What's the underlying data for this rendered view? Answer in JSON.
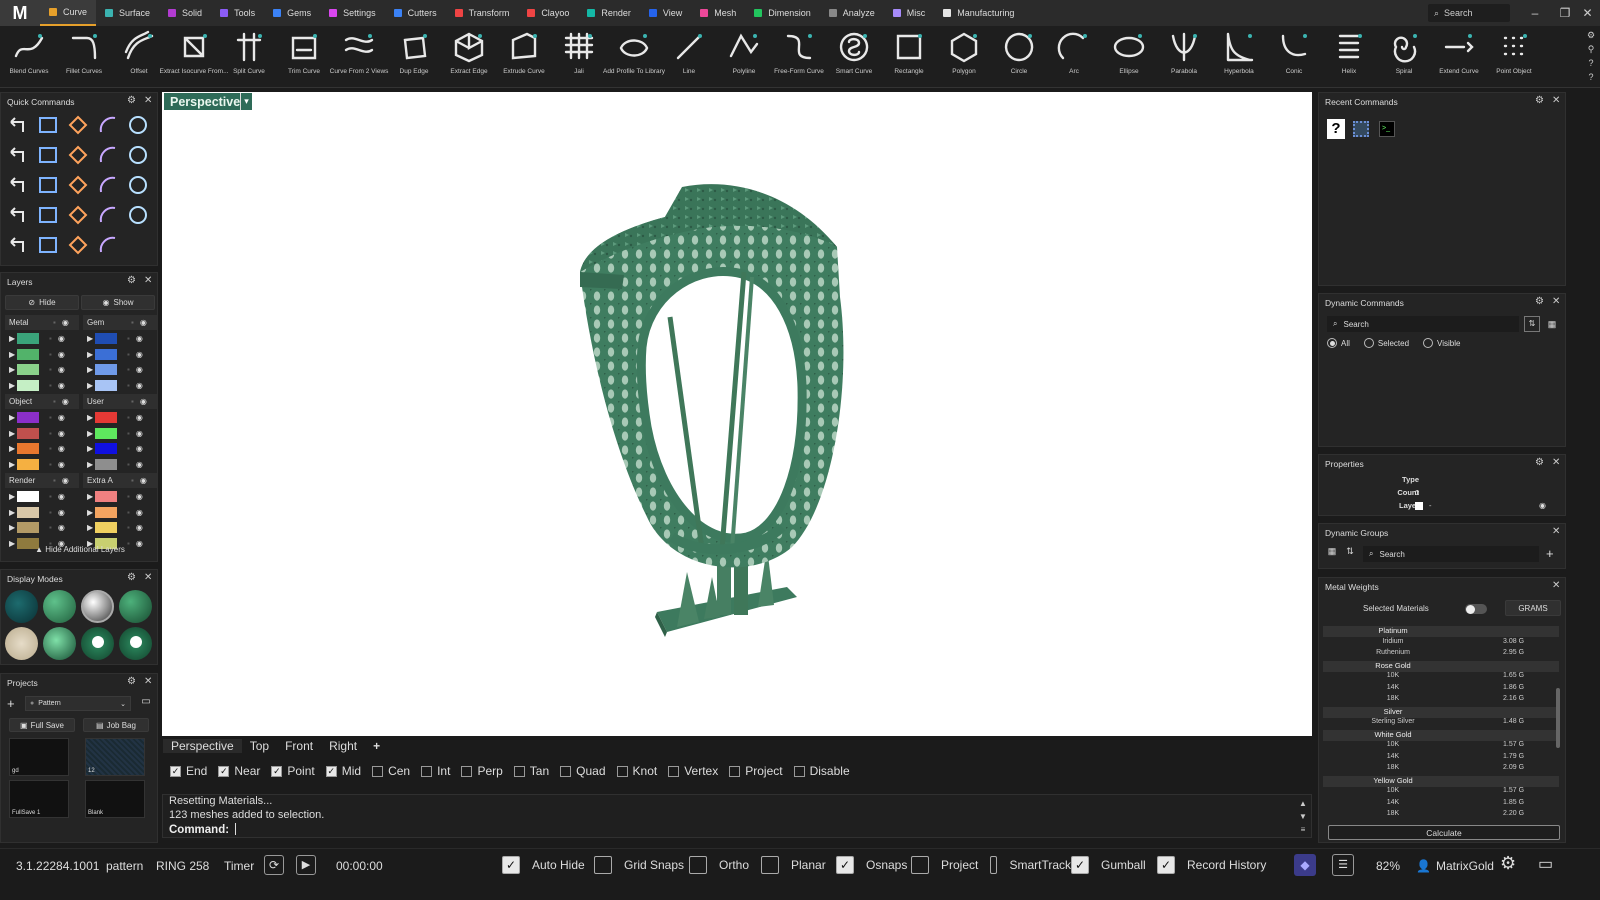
{
  "app": {
    "logo": "M"
  },
  "menu": {
    "tabs": [
      {
        "label": "Curve",
        "color": "#e6a02b"
      },
      {
        "label": "Surface",
        "color": "#3bb3b0"
      },
      {
        "label": "Solid",
        "color": "#b23bd1"
      },
      {
        "label": "Tools",
        "color": "#8b5cf6"
      },
      {
        "label": "Gems",
        "color": "#3b82f6"
      },
      {
        "label": "Settings",
        "color": "#d946ef"
      },
      {
        "label": "Cutters",
        "color": "#3b82f6"
      },
      {
        "label": "Transform",
        "color": "#ef4444"
      },
      {
        "label": "Clayoo",
        "color": "#ef4444"
      },
      {
        "label": "Render",
        "color": "#14b8a6"
      },
      {
        "label": "View",
        "color": "#2563eb"
      },
      {
        "label": "Mesh",
        "color": "#ec4899"
      },
      {
        "label": "Dimension",
        "color": "#22c55e"
      },
      {
        "label": "Analyze",
        "color": "#888888"
      },
      {
        "label": "Misc",
        "color": "#a78bfa"
      },
      {
        "label": "Manufacturing",
        "color": "#e5e5e5"
      }
    ],
    "search_placeholder": "Search"
  },
  "toolbar": {
    "tools": [
      {
        "label": "Blend Curves",
        "icon": "blend-curves-icon"
      },
      {
        "label": "Fillet Curves",
        "icon": "fillet-curves-icon"
      },
      {
        "label": "Offset",
        "icon": "offset-icon"
      },
      {
        "label": "Extract Isocurve From...",
        "icon": "extract-isocurve-icon"
      },
      {
        "label": "Split Curve",
        "icon": "split-curve-icon"
      },
      {
        "label": "Trim Curve",
        "icon": "trim-curve-icon"
      },
      {
        "label": "Curve From 2 Views",
        "icon": "curve-from-views-icon"
      },
      {
        "label": "Dup Edge",
        "icon": "dup-edge-icon"
      },
      {
        "label": "Extract Edge",
        "icon": "extract-edge-icon"
      },
      {
        "label": "Extrude Curve",
        "icon": "extrude-curve-icon"
      },
      {
        "label": "Jali",
        "icon": "jali-icon"
      },
      {
        "label": "Add Profile To Library",
        "icon": "add-profile-icon"
      },
      {
        "label": "Line",
        "icon": "line-icon"
      },
      {
        "label": "Polyline",
        "icon": "polyline-icon"
      },
      {
        "label": "Free-Form Curve",
        "icon": "freeform-curve-icon"
      },
      {
        "label": "Smart Curve",
        "icon": "smart-curve-icon"
      },
      {
        "label": "Rectangle",
        "icon": "rectangle-icon"
      },
      {
        "label": "Polygon",
        "icon": "polygon-icon"
      },
      {
        "label": "Circle",
        "icon": "circle-icon"
      },
      {
        "label": "Arc",
        "icon": "arc-icon"
      },
      {
        "label": "Ellipse",
        "icon": "ellipse-icon"
      },
      {
        "label": "Parabola",
        "icon": "parabola-icon"
      },
      {
        "label": "Hyperbola",
        "icon": "hyperbola-icon"
      },
      {
        "label": "Conic",
        "icon": "conic-icon"
      },
      {
        "label": "Helix",
        "icon": "helix-icon"
      },
      {
        "label": "Spiral",
        "icon": "spiral-icon"
      },
      {
        "label": "Extend Curve",
        "icon": "extend-curve-icon"
      },
      {
        "label": "Point Object",
        "icon": "point-object-icon"
      }
    ]
  },
  "quick_commands": {
    "title": "Quick Commands"
  },
  "layers": {
    "title": "Layers",
    "hide_label": "Hide",
    "show_label": "Show",
    "groups": [
      {
        "name": "Metal",
        "colors": [
          "#3aa37a",
          "#52b36a",
          "#8ad18a",
          "#c5efc5"
        ]
      },
      {
        "name": "Gem",
        "colors": [
          "#1f4db3",
          "#3b6fd6",
          "#6f9ae8",
          "#a8c4f5"
        ]
      },
      {
        "name": "Object",
        "colors": [
          "#8b2fc9",
          "#c0504d",
          "#e8772e",
          "#f5b041"
        ]
      },
      {
        "name": "User",
        "colors": [
          "#e53935",
          "#5ee85e",
          "#1010e0",
          "#8e8e8e"
        ]
      },
      {
        "name": "Render",
        "colors": [
          "#ffffff",
          "#d8c7a8",
          "#b39a66",
          "#8f7a3e"
        ]
      },
      {
        "name": "Extra A",
        "colors": [
          "#f08080",
          "#f4a460",
          "#f0d060",
          "#c8d070"
        ]
      }
    ],
    "footer": "Hide Additional Layers"
  },
  "display_modes": {
    "title": "Display Modes"
  },
  "projects": {
    "title": "Projects",
    "dropdown": "Pattern",
    "full_save": "Full Save",
    "job_bag": "Job Bag",
    "thumbs": [
      "gd",
      "12",
      "FullSave 1",
      "Blank"
    ]
  },
  "viewport": {
    "label": "Perspective",
    "tabs": [
      "Perspective",
      "Top",
      "Front",
      "Right"
    ],
    "add_tab": "+"
  },
  "snaps": [
    {
      "label": "End",
      "on": true
    },
    {
      "label": "Near",
      "on": true
    },
    {
      "label": "Point",
      "on": true
    },
    {
      "label": "Mid",
      "on": true
    },
    {
      "label": "Cen",
      "on": false
    },
    {
      "label": "Int",
      "on": false
    },
    {
      "label": "Perp",
      "on": false
    },
    {
      "label": "Tan",
      "on": false
    },
    {
      "label": "Quad",
      "on": false
    },
    {
      "label": "Knot",
      "on": false
    },
    {
      "label": "Vertex",
      "on": false
    },
    {
      "label": "Project",
      "on": false
    },
    {
      "label": "Disable",
      "on": false
    }
  ],
  "command": {
    "history": [
      "Resetting Materials...",
      "123 meshes added to selection."
    ],
    "prompt": "Command:"
  },
  "right": {
    "recent_commands": {
      "title": "Recent Commands"
    },
    "dynamic_commands": {
      "title": "Dynamic Commands",
      "search": "Search",
      "filters": [
        "All",
        "Selected",
        "Visible"
      ]
    },
    "properties": {
      "title": "Properties",
      "rows": [
        {
          "k": "Type",
          "v": "-"
        },
        {
          "k": "Count",
          "v": "0"
        },
        {
          "k": "Layer",
          "v": "-"
        }
      ]
    },
    "dynamic_groups": {
      "title": "Dynamic Groups",
      "search": "Search"
    },
    "metal_weights": {
      "title": "Metal Weights",
      "selected_label": "Selected Materials",
      "unit_button": "GRAMS",
      "rows": [
        {
          "group": "Platinum"
        },
        {
          "name": "Iridium",
          "val": "3.08 G"
        },
        {
          "name": "Ruthenium",
          "val": "2.95 G"
        },
        {
          "group": "Rose Gold"
        },
        {
          "name": "10K",
          "val": "1.65 G"
        },
        {
          "name": "14K",
          "val": "1.86 G"
        },
        {
          "name": "18K",
          "val": "2.16 G"
        },
        {
          "group": "Silver"
        },
        {
          "name": "Sterling Silver",
          "val": "1.48 G"
        },
        {
          "group": "White Gold"
        },
        {
          "name": "10K",
          "val": "1.57 G"
        },
        {
          "name": "14K",
          "val": "1.79 G"
        },
        {
          "name": "18K",
          "val": "2.09 G"
        },
        {
          "group": "Yellow Gold"
        },
        {
          "name": "10K",
          "val": "1.57 G"
        },
        {
          "name": "14K",
          "val": "1.85 G"
        },
        {
          "name": "18K",
          "val": "2.20 G"
        }
      ],
      "calculate": "Calculate"
    }
  },
  "status": {
    "version": "3.1.22284.1001",
    "file": "pattern",
    "model": "RING 258",
    "timer_label": "Timer",
    "timer_value": "00:00:00",
    "toggles": [
      {
        "label": "Auto Hide",
        "on": true
      },
      {
        "label": "Grid Snaps",
        "on": false
      },
      {
        "label": "Ortho",
        "on": false
      },
      {
        "label": "Planar",
        "on": false
      },
      {
        "label": "Osnaps",
        "on": true
      },
      {
        "label": "Project",
        "on": false
      },
      {
        "label": "SmartTrack",
        "on": false
      },
      {
        "label": "Gumball",
        "on": true
      },
      {
        "label": "Record History",
        "on": true
      }
    ],
    "zoom": "82%",
    "user": "MatrixGold"
  },
  "colors": {
    "accent": "#e6a02b",
    "ring_green": "#3d7a5e",
    "viewport_tab": "#2e6b58"
  }
}
